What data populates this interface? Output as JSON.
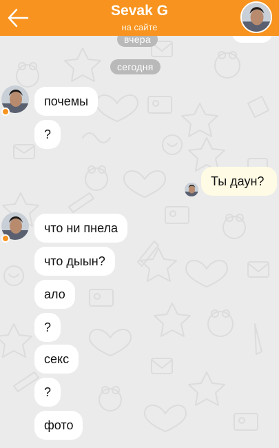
{
  "header": {
    "contact_name": "Sevak G",
    "status": "на сайте",
    "back_icon": "arrow-left-icon",
    "accent_color": "#f7931e"
  },
  "dates": {
    "yesterday": "вчера",
    "today": "сегодня"
  },
  "messages": [
    {
      "direction": "in",
      "text": "почемы"
    },
    {
      "direction": "in",
      "text": "?"
    },
    {
      "direction": "out",
      "text": "Ты даун?"
    },
    {
      "direction": "in",
      "text": "что ни пнела"
    },
    {
      "direction": "in",
      "text": "что дыын?"
    },
    {
      "direction": "in",
      "text": "ало"
    },
    {
      "direction": "in",
      "text": "?"
    },
    {
      "direction": "in",
      "text": "секс"
    },
    {
      "direction": "in",
      "text": "?"
    },
    {
      "direction": "in",
      "text": "фото"
    }
  ]
}
